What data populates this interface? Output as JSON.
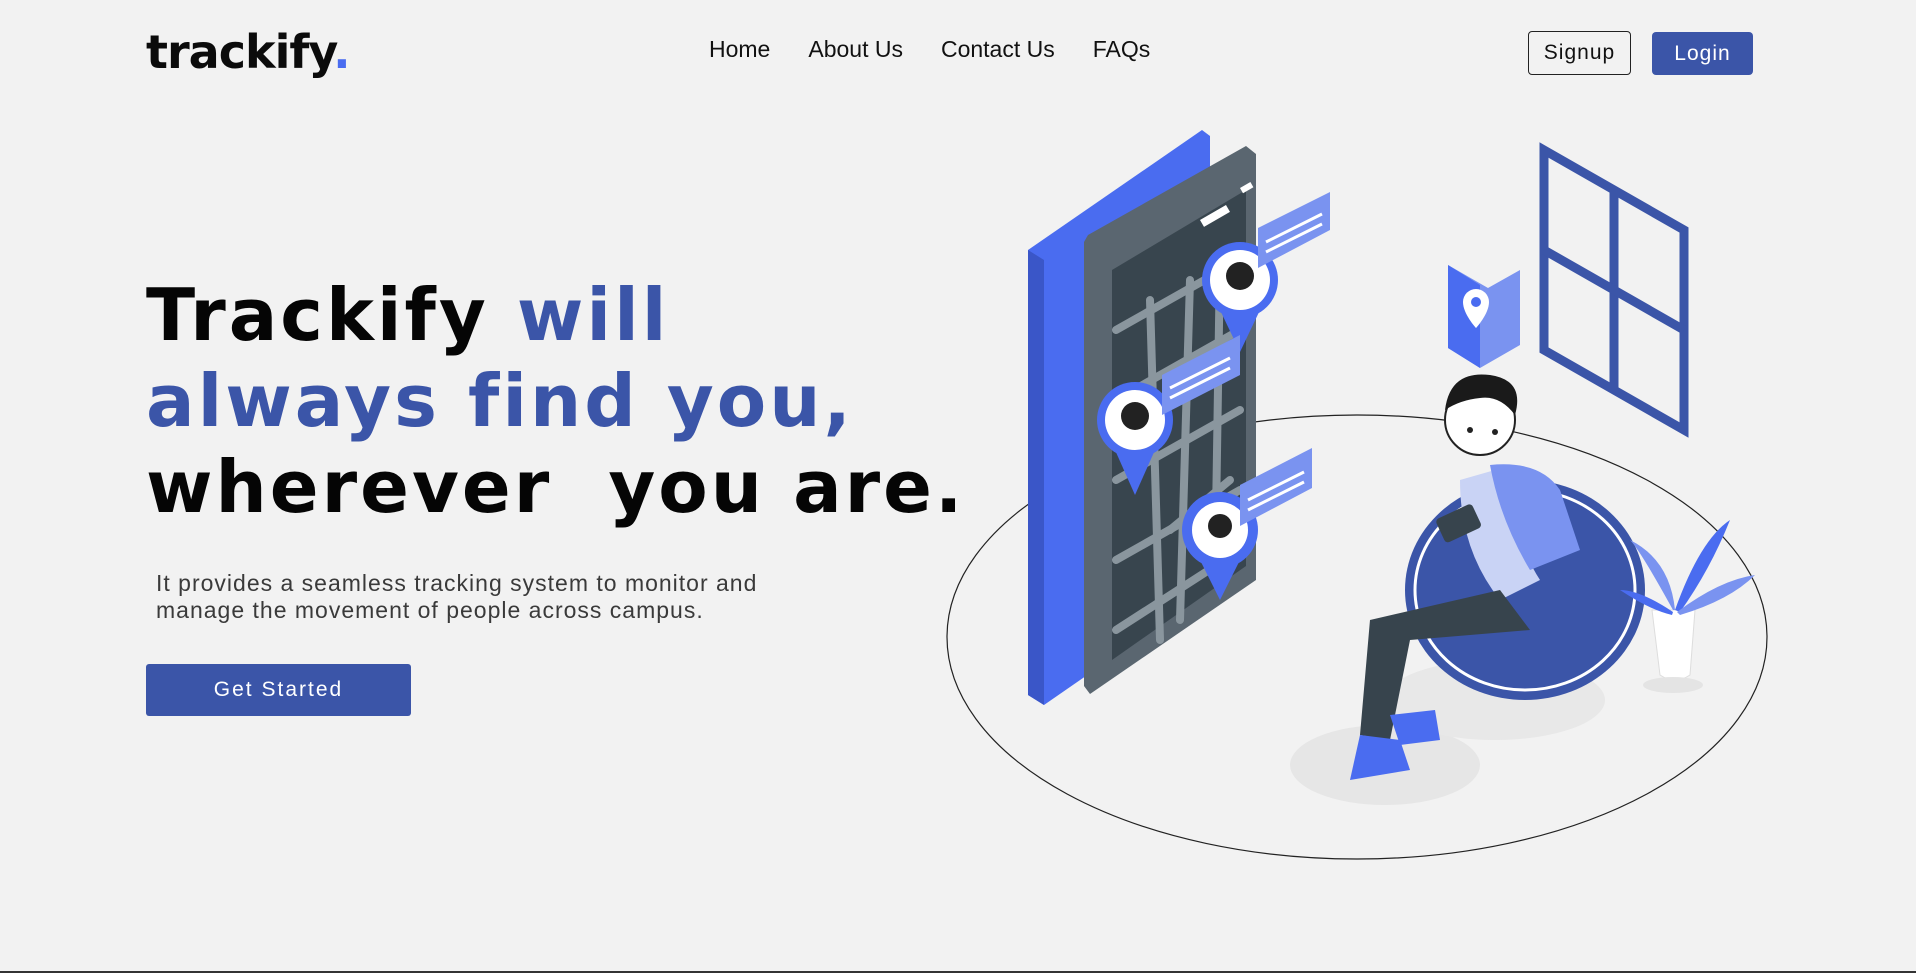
{
  "brand": {
    "name": "trackify",
    "dot": ".",
    "accent_color": "#3b55a8"
  },
  "nav": {
    "links": [
      "Home",
      "About Us",
      "Contact Us",
      "FAQs"
    ],
    "signup_label": "Signup",
    "login_label": "Login"
  },
  "hero": {
    "title_part1": "Trackify ",
    "title_accent1": "will",
    "title_accent2": "always find you,",
    "title_part2": "wherever  you are.",
    "description": "It provides a seamless tracking system to monitor and manage the movement of people across campus.",
    "cta_label": "Get Started"
  },
  "illustration": {
    "icons": [
      "phone-map-icon",
      "person-sitting-icon",
      "location-pin-icon",
      "window-icon",
      "plant-icon"
    ]
  }
}
